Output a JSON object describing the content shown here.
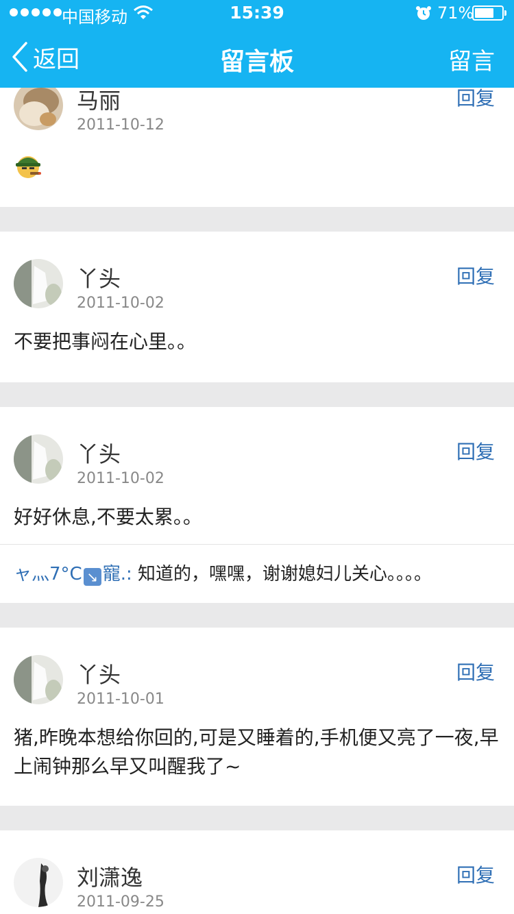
{
  "status_bar": {
    "carrier": "中国移动",
    "time": "15:39",
    "battery_percent": "71%",
    "battery_level": 0.71
  },
  "nav": {
    "back_label": "返回",
    "title": "留言板",
    "right_action": "留言"
  },
  "reply_label": "回复",
  "messages": [
    {
      "author": "马丽",
      "date": "2011-10-12",
      "content": "",
      "emoji": "smoking-soldier-emoji"
    },
    {
      "author": "丫头",
      "date": "2011-10-02",
      "content": "不要把事闷在心里。。"
    },
    {
      "author": "丫头",
      "date": "2011-10-02",
      "content": "好好休息,不要太累。。",
      "reply": {
        "author_prefix": "ャ灬7°C",
        "author_suffix": "寵.:",
        "text": " 知道的，嘿嘿，谢谢媳妇儿关心。。。。"
      }
    },
    {
      "author": "丫头",
      "date": "2011-10-01",
      "content": "猪,昨晚本想给你回的,可是又睡着的,手机便又亮了一夜,早上闹钟那么早又叫醒我了~"
    },
    {
      "author": "刘潇逸",
      "date": "2011-09-25",
      "content": ""
    }
  ]
}
